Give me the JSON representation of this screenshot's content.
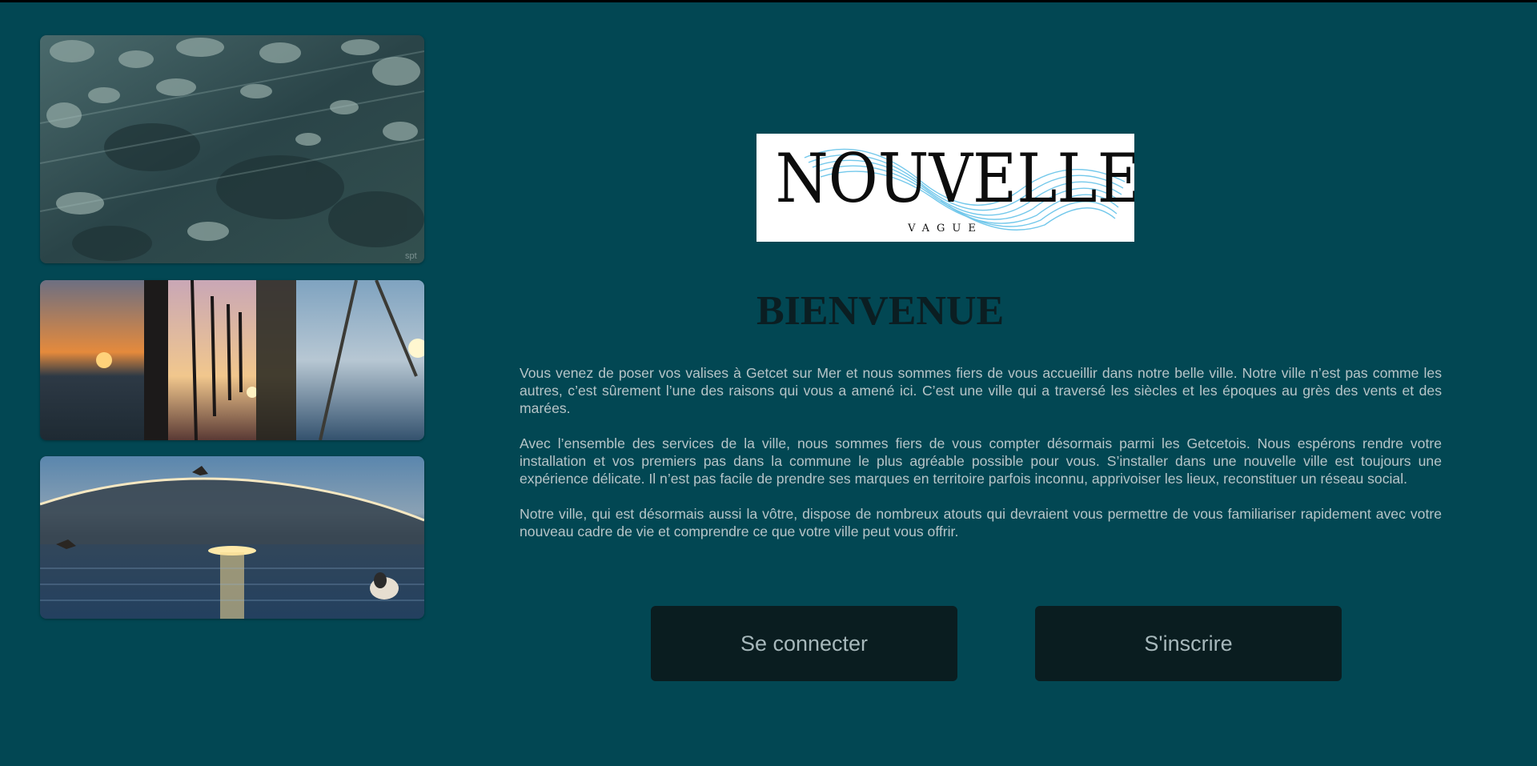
{
  "gallery": {
    "photos": [
      {
        "name": "sea-rocks-photo",
        "watermark": "spt"
      },
      {
        "name": "sunset-collage-photo"
      },
      {
        "name": "sea-sunset-birds-photo"
      }
    ]
  },
  "logo": {
    "word": "NOUVELLE",
    "sub": "VAGUE"
  },
  "main": {
    "title": "BIENVENUE",
    "paragraphs": [
      "Vous venez de poser vos valises à Getcet sur Mer et nous sommes fiers de vous accueillir dans notre belle ville. Notre ville n’est pas comme les autres, c’est sûrement l’une des raisons qui vous a amené ici. C’est une ville qui a traversé les siècles et les époques au grès des vents et des marées.",
      "Avec l’ensemble des services de la ville, nous sommes fiers de vous compter désormais parmi les Getcetois. Nous espérons rendre votre installation et vos premiers pas dans la commune le plus agréable possible pour vous. S’installer dans une nouvelle ville est toujours une expérience délicate. Il n’est pas facile de prendre ses marques en territoire parfois inconnu, apprivoiser les lieux, reconstituer un réseau social.",
      "Notre ville, qui est désormais aussi la vôtre, dispose de nombreux atouts qui devraient vous permettre de vous familiariser rapidement avec votre nouveau cadre de vie et comprendre ce que votre ville peut vous offrir."
    ]
  },
  "actions": {
    "login_label": "Se connecter",
    "signup_label": "S'inscrire"
  },
  "colors": {
    "background": "#024753",
    "button": "#0a1d20",
    "text": "#b7c5c8",
    "title": "#0b1e22",
    "logo_wave": "#5bbfe8"
  }
}
